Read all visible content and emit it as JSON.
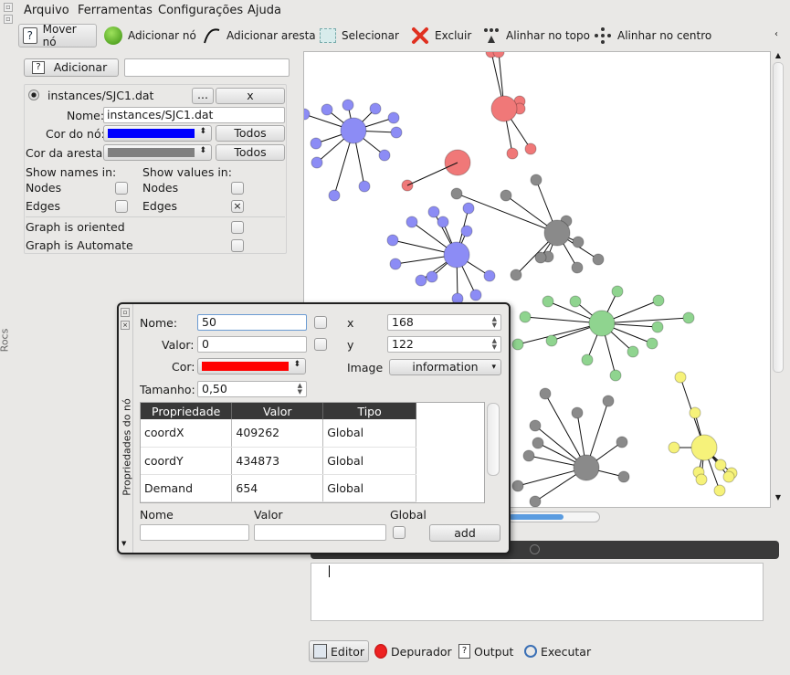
{
  "menu": [
    "Arquivo",
    "Ferramentas",
    "Configurações",
    "Ajuda"
  ],
  "toolbar": [
    {
      "label": "Mover nó",
      "icon": "help-cursor-icon",
      "name": "tool-move-node"
    },
    {
      "label": "Adicionar nó",
      "icon": "green-ball-icon",
      "name": "tool-add-node"
    },
    {
      "label": "Adicionar aresta",
      "icon": "curve-icon",
      "name": "tool-add-edge"
    },
    {
      "label": "Selecionar",
      "icon": "selection-rect-icon",
      "name": "tool-select"
    },
    {
      "label": "Excluir",
      "icon": "red-x-icon",
      "name": "tool-delete"
    },
    {
      "label": "Alinhar no topo",
      "icon": "align-top-icon",
      "name": "tool-align-top"
    },
    {
      "label": "Alinhar no centro",
      "icon": "align-center-icon",
      "name": "tool-align-center"
    }
  ],
  "left": {
    "add_button": "Adicionar",
    "graph_file": "instances/SJC1.dat",
    "browse_button": "...",
    "close_button": "x",
    "name_label": "Nome:",
    "name_value": "instances/SJC1.dat",
    "node_color_label": "Cor do nó:",
    "node_color": "#0000ff",
    "edge_color_label": "Cor da aresta:",
    "edge_color": "#808080",
    "all_button": "Todos",
    "show_names_label": "Show names in:",
    "show_values_label": "Show values in:",
    "nodes_label": "Nodes",
    "edges_label": "Edges",
    "edges_values_checked": "×",
    "oriented_label": "Graph is oriented",
    "automate_label": "Graph is Automate",
    "side_label": "Rocs"
  },
  "dialog": {
    "side_title": "Propriedades do nó",
    "name_label": "Nome:",
    "name_value": "50",
    "value_label": "Valor:",
    "value_value": "0",
    "color_label": "Cor:",
    "color": "#ff0000",
    "size_label": "Tamanho:",
    "size_value": "0,50",
    "x_label": "x",
    "x_value": "168",
    "y_label": "y",
    "y_value": "122",
    "image_label": "Image",
    "image_value": "information",
    "columns": [
      "Propriedade",
      "Valor",
      "Tipo"
    ],
    "rows": [
      [
        "coordX",
        "409262",
        "Global"
      ],
      [
        "coordY",
        "434873",
        "Global"
      ],
      [
        "Demand",
        "654",
        "Global"
      ]
    ],
    "new_name_label": "Nome",
    "new_value_label": "Valor",
    "global_label": "Global",
    "add_button": "add"
  },
  "bottom_tabs": [
    {
      "label": "Editor",
      "icon": "editor-icon",
      "name": "tab-editor"
    },
    {
      "label": "Depurador",
      "icon": "bug-icon",
      "name": "tab-debugger"
    },
    {
      "label": "Output",
      "icon": "output-icon",
      "name": "tab-output"
    },
    {
      "label": "Executar",
      "icon": "run-icon",
      "name": "tab-run"
    }
  ],
  "colors": {
    "blue_node": "#8c8cf5",
    "red_node": "#f07878",
    "gray_node": "#8a8a8a",
    "green_node": "#8fd48f",
    "yellow_node": "#f6f27a"
  }
}
